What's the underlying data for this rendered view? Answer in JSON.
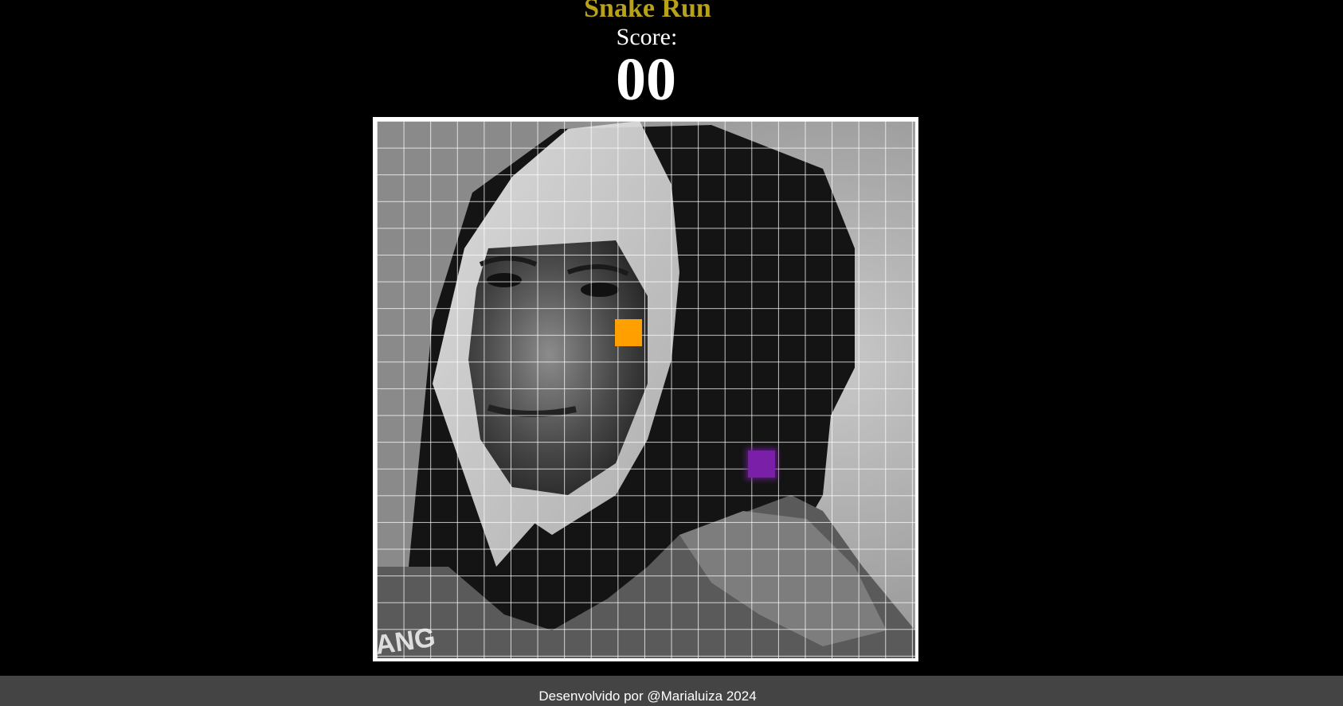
{
  "header": {
    "title": "Snake Run",
    "title_color": "#b8a21a",
    "score_label": "Score:",
    "score_value": "00"
  },
  "board": {
    "grid_columns": 20,
    "grid_rows": 20,
    "food_color": "#ffa000",
    "snake_color": "#7a1fa8"
  },
  "footer": {
    "text": "Desenvolvido por @Marialuiza 2024"
  }
}
